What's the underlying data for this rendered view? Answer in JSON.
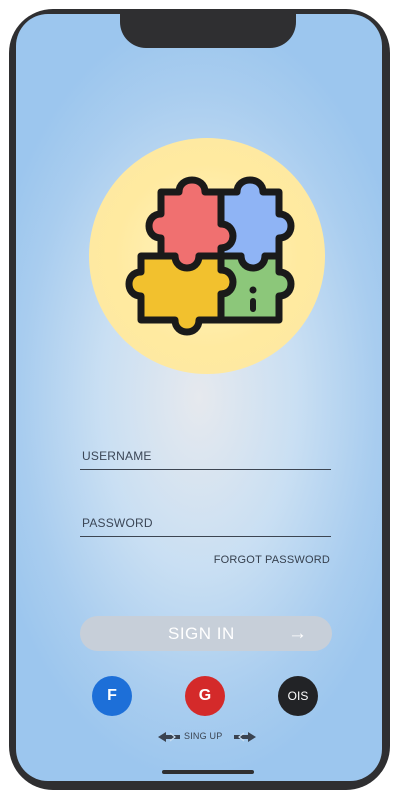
{
  "login": {
    "username_placeholder": "USERNAME",
    "password_placeholder": "PASSWORD",
    "forgot_password": "FORGOT PASSWORD",
    "sign_in_label": "SIGN IN",
    "sign_in_arrow": "→"
  },
  "social": {
    "facebook_label": "F",
    "google_label": "G",
    "ios_label": "OIS"
  },
  "signup": {
    "label": "SING UP"
  },
  "colors": {
    "facebook": "#1d6fd8",
    "google": "#d42a2a",
    "ios": "#222326",
    "signin_button": "#c7cfd9",
    "logo_circle": "#ffeaa0",
    "puzzle_red": "#f07070",
    "puzzle_blue": "#8fb4f5",
    "puzzle_yellow": "#f2c12e",
    "puzzle_green": "#8cc77a"
  },
  "icons": {
    "logo": "puzzle-pieces-icon",
    "signin_arrow": "arrow-right-icon",
    "signup_arrows": "double-arrow-icon"
  }
}
